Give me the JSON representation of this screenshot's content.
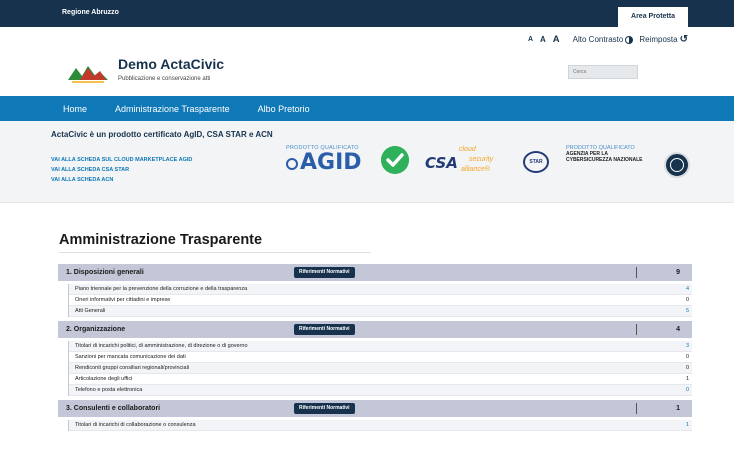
{
  "topbar": {
    "region": "Regione Abruzzo",
    "area_protetta": "Area Protetta"
  },
  "accessibility": {
    "font_small": "A",
    "font_mid": "A",
    "font_big": "A",
    "contrast": "Alto Contrasto",
    "contrast_icon": "contrast-icon",
    "reset": "Reimposta",
    "reset_icon": "undo-icon"
  },
  "header": {
    "title": "Demo ActaCivic",
    "subtitle": "Pubblicazione e conservazione atti",
    "search_placeholder": "Cerca"
  },
  "nav": {
    "items": [
      "Home",
      "Administrazione Trasparente",
      "Albo Pretorio"
    ]
  },
  "cert": {
    "headline": "ActaCivic è un prodotto certificato AgID, CSA STAR e ACN",
    "links": [
      "VAI ALLA SCHEDA SUL CLOUD MARKETPLACE AGID",
      "VAI ALLA SCHEDA CSA STAR",
      "VAI ALLA SCHEDA ACN"
    ],
    "agid_caption": "PRODOTTO QUALIFICATO",
    "agid_word": "AGID",
    "csa_word": "CSA",
    "csa_cloud": "cloud",
    "csa_security": "security",
    "csa_alliance": "alliance®",
    "star_word": "STAR",
    "acn_caption": "PRODOTTO QUALIFICATO",
    "acn_line1": "AGENZIA PER LA",
    "acn_line2": "CYBERSICUREZZA NAZIONALE"
  },
  "section_title": "Amministrazione Trasparente",
  "reference_button": "Riferimenti Normativi",
  "categories": [
    {
      "name": "1. Disposizioni generali",
      "count": "9",
      "items": [
        {
          "name": "Piano triennale per la prevenzione della corruzione e della trasparenza",
          "count": "4"
        },
        {
          "name": "Oneri informativi per cittadini e imprese",
          "count": "0"
        },
        {
          "name": "Atti Generali",
          "count": "5"
        }
      ]
    },
    {
      "name": "2. Organizzazione",
      "count": "4",
      "items": [
        {
          "name": "Titolari di incarichi politici, di amministrazione, di direzione o di governo",
          "count": "3"
        },
        {
          "name": "Sanzioni per mancata comunicazione dei dati",
          "count": "0"
        },
        {
          "name": "Rendiconti gruppi consiliari regionali/provinciali",
          "count": "0"
        },
        {
          "name": "Articolazione degli uffici",
          "count": "1"
        },
        {
          "name": "Telefono e posta elettronica",
          "count": "0"
        }
      ]
    },
    {
      "name": "3. Consulenti e collaboratori",
      "count": "1",
      "items": [
        {
          "name": "Titolari di incarichi di collaborazione o consulenza",
          "count": "1"
        }
      ]
    }
  ],
  "colors": {
    "topbar": "#17324d",
    "nav": "#0f78b6",
    "category_bar": "#c3c7d7",
    "link": "#0f78b6"
  }
}
